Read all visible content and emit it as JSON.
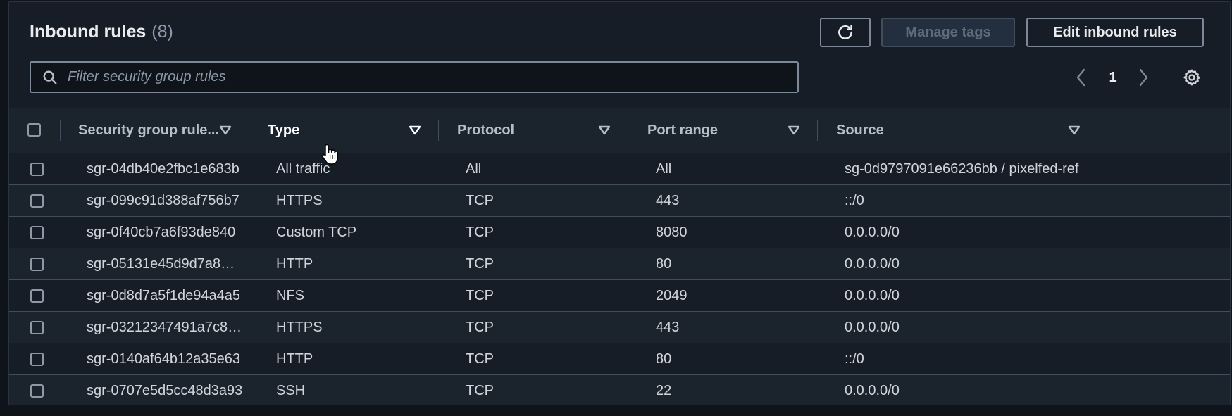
{
  "header": {
    "title": "Inbound rules",
    "count": "(8)",
    "refresh_icon": "refresh-icon",
    "manage_tags_label": "Manage tags",
    "edit_label": "Edit inbound rules"
  },
  "search": {
    "placeholder": "Filter security group rules",
    "value": ""
  },
  "pagination": {
    "current_page": "1",
    "prev_icon": "chevron-left-icon",
    "next_icon": "chevron-right-icon",
    "settings_icon": "gear-icon"
  },
  "table": {
    "columns": [
      {
        "label": "Security group rule...",
        "sortable": true
      },
      {
        "label": "Type",
        "sortable": true,
        "active": true
      },
      {
        "label": "Protocol",
        "sortable": true
      },
      {
        "label": "Port range",
        "sortable": true
      },
      {
        "label": "Source",
        "sortable": true
      }
    ],
    "rows": [
      {
        "id": "sgr-04db40e2fbc1e683b",
        "type": "All traffic",
        "protocol": "All",
        "port": "All",
        "source": "sg-0d9797091e66236bb / pixelfed-ref"
      },
      {
        "id": "sgr-099c91d388af756b7",
        "type": "HTTPS",
        "protocol": "TCP",
        "port": "443",
        "source": "::/0"
      },
      {
        "id": "sgr-0f40cb7a6f93de840",
        "type": "Custom TCP",
        "protocol": "TCP",
        "port": "8080",
        "source": "0.0.0.0/0"
      },
      {
        "id": "sgr-05131e45d9d7a8…",
        "type": "HTTP",
        "protocol": "TCP",
        "port": "80",
        "source": "0.0.0.0/0"
      },
      {
        "id": "sgr-0d8d7a5f1de94a4a5",
        "type": "NFS",
        "protocol": "TCP",
        "port": "2049",
        "source": "0.0.0.0/0"
      },
      {
        "id": "sgr-03212347491a7c8…",
        "type": "HTTPS",
        "protocol": "TCP",
        "port": "443",
        "source": "0.0.0.0/0"
      },
      {
        "id": "sgr-0140af64b12a35e63",
        "type": "HTTP",
        "protocol": "TCP",
        "port": "80",
        "source": "::/0"
      },
      {
        "id": "sgr-0707e5d5cc48d3a93",
        "type": "SSH",
        "protocol": "TCP",
        "port": "22",
        "source": "0.0.0.0/0"
      }
    ]
  },
  "colors": {
    "background": "#0f141a",
    "panel": "#161d26",
    "border": "#414d5c",
    "text": "#d1d5db",
    "disabled_text": "#5f6b7a"
  }
}
